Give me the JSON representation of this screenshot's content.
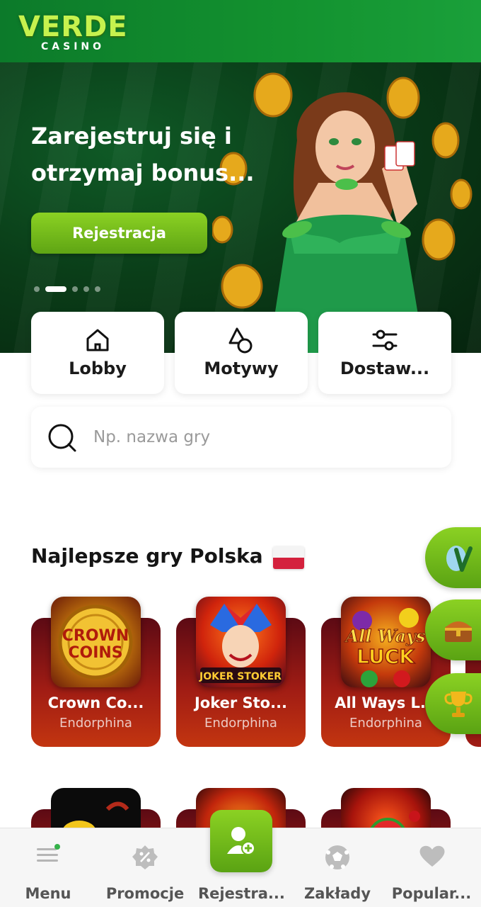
{
  "brand": {
    "logo_word": "VERDE",
    "logo_sub": "CASINO",
    "primary_color": "#6cb51a",
    "header_color": "#0f8a2e"
  },
  "hero": {
    "title": "Zarejestruj się i otrzymaj bonus...",
    "cta_label": "Rejestracja",
    "carousel_active_index": 1,
    "carousel_count": 5
  },
  "categories": [
    {
      "label": "Lobby",
      "icon": "home-icon"
    },
    {
      "label": "Motywy",
      "icon": "shapes-icon"
    },
    {
      "label": "Dostaw...",
      "icon": "sliders-icon"
    }
  ],
  "search": {
    "placeholder": "Np. nazwa gry",
    "value": ""
  },
  "section": {
    "title": "Najlepsze gry Polska",
    "flag": "poland-flag-icon"
  },
  "games": [
    {
      "name": "Crown Co...",
      "provider": "Endorphina",
      "art_text": "CROWN COINS"
    },
    {
      "name": "Joker Sto...",
      "provider": "Endorphina",
      "art_text": "JOKER STOKER"
    },
    {
      "name": "All Ways L...",
      "provider": "Endorphina",
      "art_text": "All Ways LUCK"
    }
  ],
  "side_buttons": [
    "verde-egg-icon",
    "treasure-chest-icon",
    "trophy-icon"
  ],
  "bottom_nav": [
    {
      "label": "Menu",
      "icon": "menu-icon"
    },
    {
      "label": "Promocje",
      "icon": "percent-badge-icon"
    },
    {
      "label": "Rejestra...",
      "icon": "add-user-icon"
    },
    {
      "label": "Zakłady",
      "icon": "soccer-ball-icon"
    },
    {
      "label": "Popular...",
      "icon": "heart-icon"
    }
  ]
}
